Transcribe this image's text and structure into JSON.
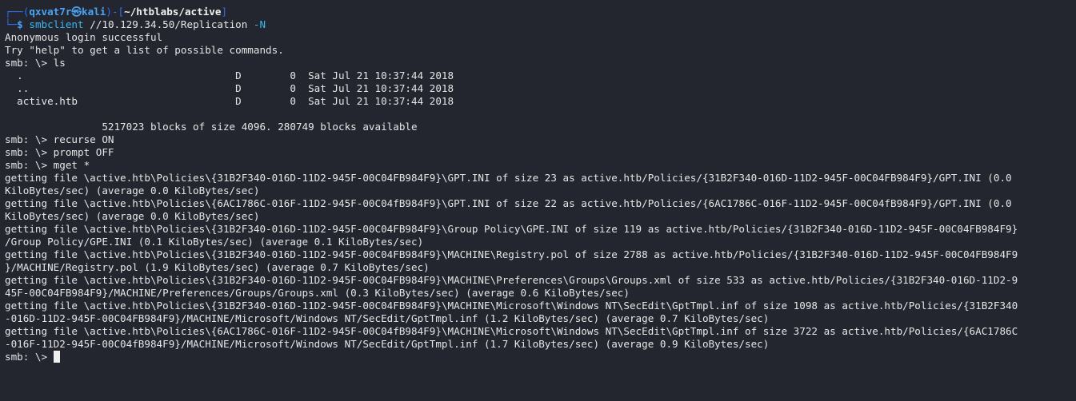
{
  "prompt": {
    "corner_top": "┌──",
    "corner_bottom": "└─",
    "open_paren": "(",
    "user_host_separator": "㉿",
    "user": "qxvat7r",
    "host": "kali",
    "close_paren": ")",
    "dash_bracket_open": "-[",
    "cwd": "~/htblabs/active",
    "bracket_close": "]",
    "symbol": "$",
    "command": "smbclient",
    "args": " //10.129.34.50/Replication",
    "flag": " -N"
  },
  "output_lines": [
    "Anonymous login successful",
    "Try \"help\" to get a list of possible commands.",
    "smb: \\> ls",
    "  .                                   D        0  Sat Jul 21 10:37:44 2018",
    "  ..                                  D        0  Sat Jul 21 10:37:44 2018",
    "  active.htb                          D        0  Sat Jul 21 10:37:44 2018",
    "",
    "                5217023 blocks of size 4096. 280749 blocks available",
    "smb: \\> recurse ON",
    "smb: \\> prompt OFF",
    "smb: \\> mget *",
    "getting file \\active.htb\\Policies\\{31B2F340-016D-11D2-945F-00C04FB984F9}\\GPT.INI of size 23 as active.htb/Policies/{31B2F340-016D-11D2-945F-00C04FB984F9}/GPT.INI (0.0",
    "KiloBytes/sec) (average 0.0 KiloBytes/sec)",
    "getting file \\active.htb\\Policies\\{6AC1786C-016F-11D2-945F-00C04fB984F9}\\GPT.INI of size 22 as active.htb/Policies/{6AC1786C-016F-11D2-945F-00C04fB984F9}/GPT.INI (0.0",
    "KiloBytes/sec) (average 0.0 KiloBytes/sec)",
    "getting file \\active.htb\\Policies\\{31B2F340-016D-11D2-945F-00C04FB984F9}\\Group Policy\\GPE.INI of size 119 as active.htb/Policies/{31B2F340-016D-11D2-945F-00C04FB984F9}",
    "/Group Policy/GPE.INI (0.1 KiloBytes/sec) (average 0.1 KiloBytes/sec)",
    "getting file \\active.htb\\Policies\\{31B2F340-016D-11D2-945F-00C04FB984F9}\\MACHINE\\Registry.pol of size 2788 as active.htb/Policies/{31B2F340-016D-11D2-945F-00C04FB984F9",
    "}/MACHINE/Registry.pol (1.9 KiloBytes/sec) (average 0.7 KiloBytes/sec)",
    "getting file \\active.htb\\Policies\\{31B2F340-016D-11D2-945F-00C04FB984F9}\\MACHINE\\Preferences\\Groups\\Groups.xml of size 533 as active.htb/Policies/{31B2F340-016D-11D2-9",
    "45F-00C04FB984F9}/MACHINE/Preferences/Groups/Groups.xml (0.3 KiloBytes/sec) (average 0.6 KiloBytes/sec)",
    "getting file \\active.htb\\Policies\\{31B2F340-016D-11D2-945F-00C04FB984F9}\\MACHINE\\Microsoft\\Windows NT\\SecEdit\\GptTmpl.inf of size 1098 as active.htb/Policies/{31B2F340",
    "-016D-11D2-945F-00C04FB984F9}/MACHINE/Microsoft/Windows NT/SecEdit/GptTmpl.inf (1.2 KiloBytes/sec) (average 0.7 KiloBytes/sec)",
    "getting file \\active.htb\\Policies\\{6AC1786C-016F-11D2-945F-00C04fB984F9}\\MACHINE\\Microsoft\\Windows NT\\SecEdit\\GptTmpl.inf of size 3722 as active.htb/Policies/{6AC1786C",
    "-016F-11D2-945F-00C04fB984F9}/MACHINE/Microsoft/Windows NT/SecEdit/GptTmpl.inf (1.7 KiloBytes/sec) (average 0.9 KiloBytes/sec)"
  ],
  "final_prompt": "smb: \\> ",
  "colors": {
    "background": "#23262e",
    "prompt_frame": "#2f6df2",
    "user_host": "#4aa3f5",
    "cwd": "#f2f2f2",
    "command": "#3cb6f0",
    "text": "#e6e6e6"
  }
}
